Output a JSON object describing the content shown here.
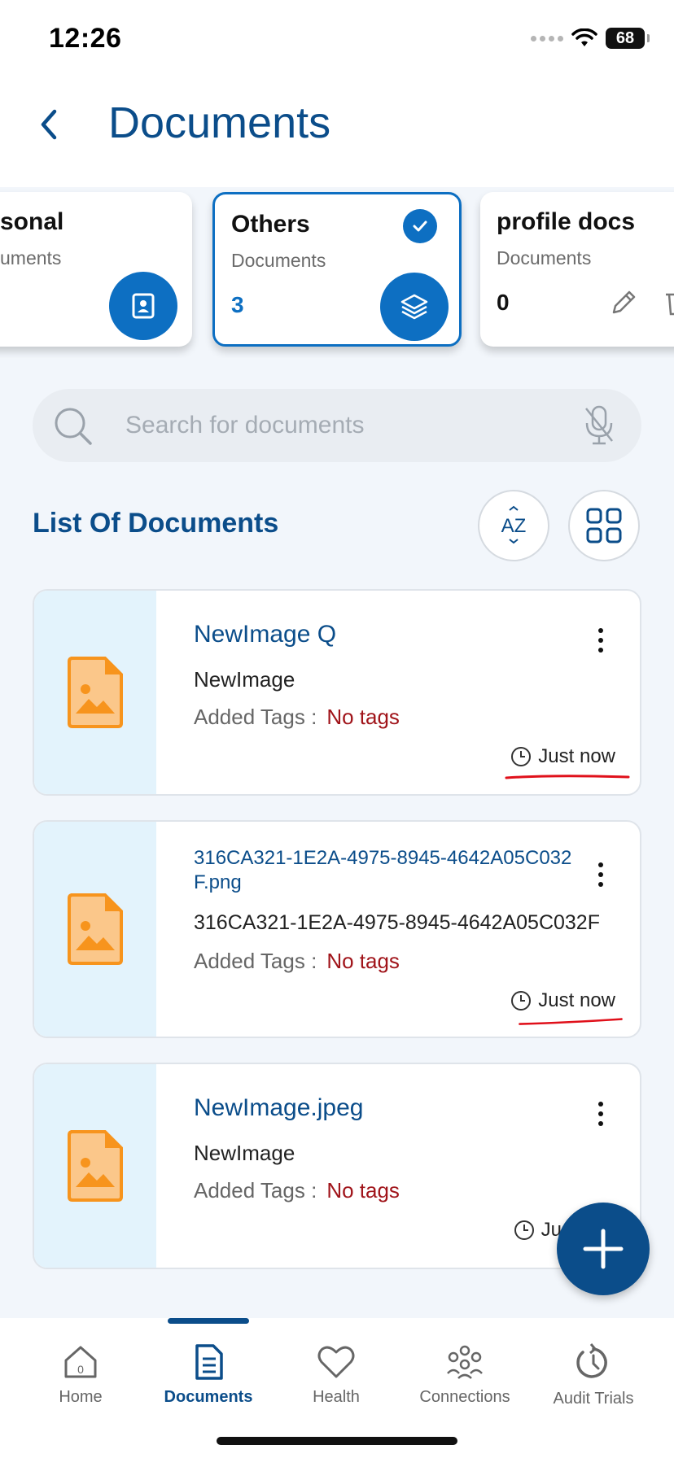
{
  "status_bar": {
    "time": "12:26",
    "battery": "68"
  },
  "header": {
    "title": "Documents"
  },
  "folders": [
    {
      "name": "sonal",
      "subtitle": "uments",
      "count": ""
    },
    {
      "name": "Others",
      "subtitle": "Documents",
      "count": "3"
    },
    {
      "name": "profile docs",
      "subtitle": "Documents",
      "count": "0"
    }
  ],
  "search": {
    "placeholder": "Search for documents"
  },
  "list": {
    "title": "List Of Documents",
    "sort_icon_text": "AZ"
  },
  "documents": [
    {
      "name": "NewImage Q",
      "subtitle": "NewImage",
      "tags_label": "Added Tags :",
      "tags_value": "No tags",
      "time": "Just now"
    },
    {
      "name": "316CA321-1E2A-4975-8945-4642A05C032F.png",
      "subtitle": "316CA321-1E2A-4975-8945-4642A05C032F",
      "tags_label": "Added Tags :",
      "tags_value": "No tags",
      "time": "Just now"
    },
    {
      "name": "NewImage.jpeg",
      "subtitle": "NewImage",
      "tags_label": "Added Tags :",
      "tags_value": "No tags",
      "time": "Ju"
    }
  ],
  "tabs": [
    {
      "label": "Home",
      "icon": "home-icon"
    },
    {
      "label": "Documents",
      "icon": "document-icon",
      "active": true
    },
    {
      "label": "Health",
      "icon": "heart-icon"
    },
    {
      "label": "Connections",
      "icon": "connections-icon"
    },
    {
      "label": "Audit Trials",
      "icon": "audit-icon"
    }
  ],
  "colors": {
    "primary": "#0b4d8a",
    "accent": "#0d6fc2",
    "tags_value": "#a0141a",
    "file_icon": "#f7941d",
    "thumb_bg": "#e3f3fc",
    "annotation": "#e0101a"
  }
}
